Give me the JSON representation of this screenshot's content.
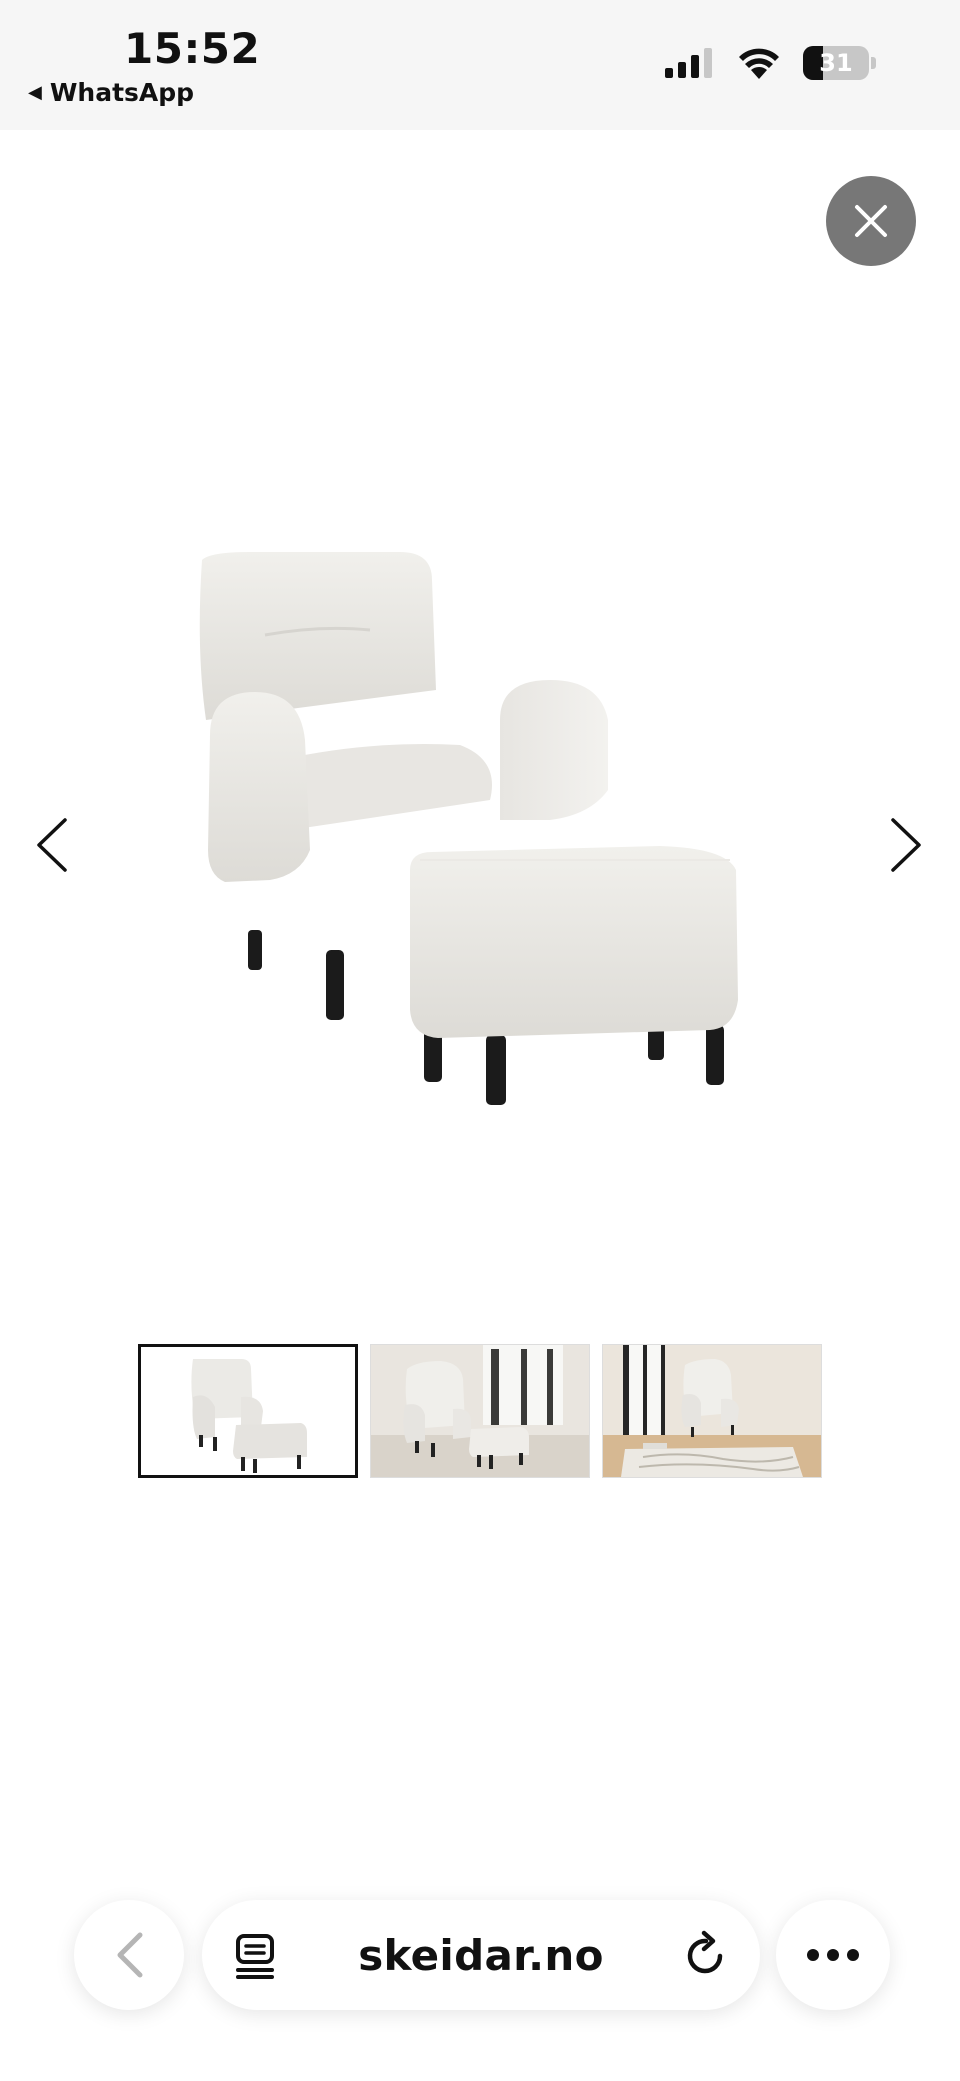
{
  "status_bar": {
    "time": "15:52",
    "back_app": "WhatsApp",
    "battery_level": "31",
    "battery_fraction": 0.31,
    "icons": [
      "cellular-signal-icon",
      "wifi-icon",
      "battery-icon"
    ]
  },
  "viewer": {
    "close_icon": "close-icon",
    "prev_icon": "chevron-left-icon",
    "next_icon": "chevron-right-icon",
    "product_image": "white boucle armchair with footstool",
    "thumbnails": [
      {
        "scene": "armchair with footstool on white",
        "active": true
      },
      {
        "scene": "armchair and footstool in living room",
        "active": false
      },
      {
        "scene": "armchair in room with patterned rug",
        "active": false
      }
    ]
  },
  "browser_toolbar": {
    "url": "skeidar.no",
    "back_icon": "chevron-left-icon",
    "reader_icon": "reader-icon",
    "reload_icon": "reload-icon",
    "more_icon": "more-icon"
  },
  "colors": {
    "status_bg": "#f6f6f6",
    "close_button_bg": "#777777",
    "chair_fabric": "#ecebe7",
    "chair_legs": "#1b1b1b"
  }
}
